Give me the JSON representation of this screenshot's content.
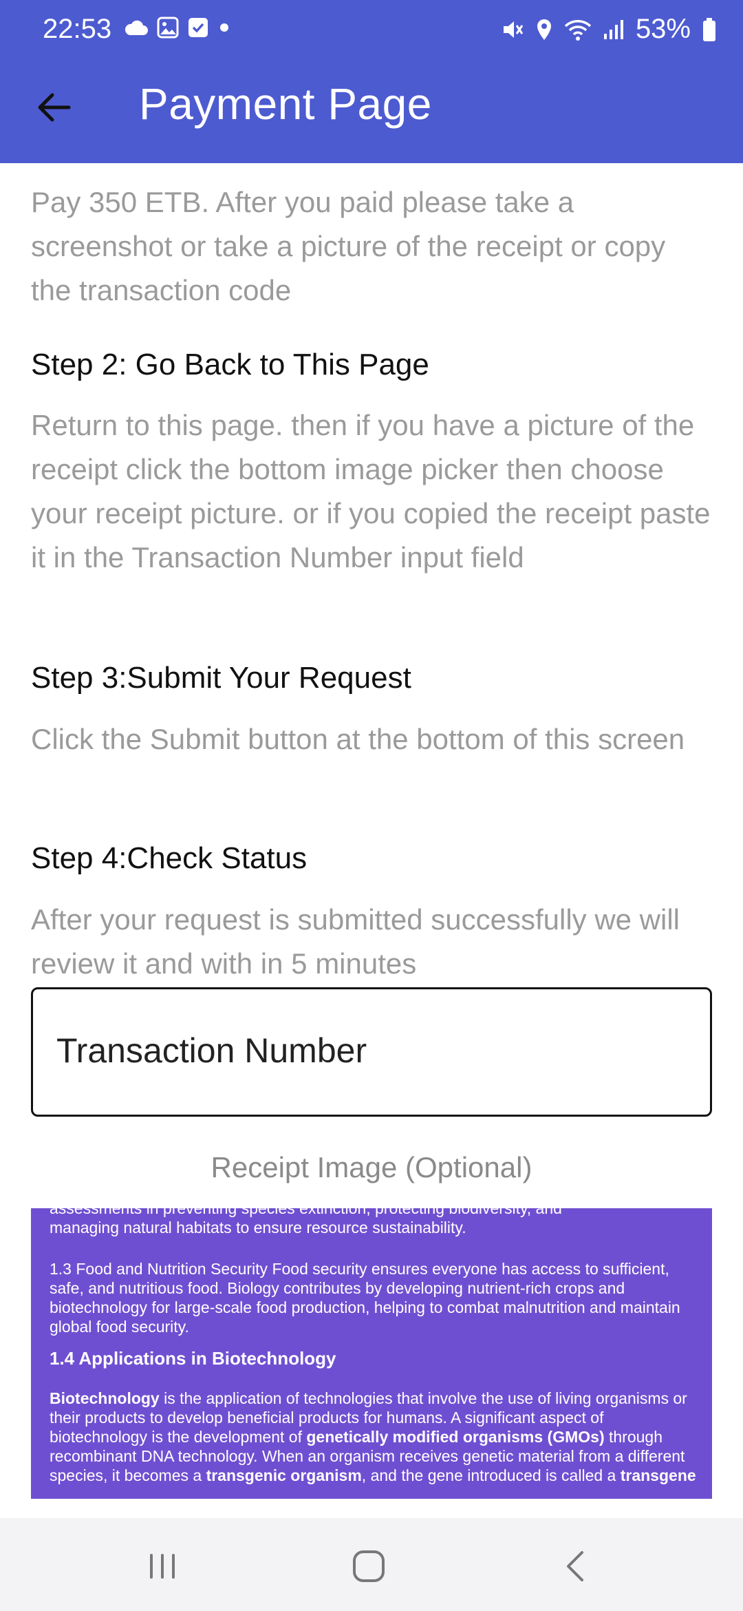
{
  "status_bar": {
    "time": "22:53",
    "battery": "53%",
    "left_icons": [
      "cloud-icon",
      "image-icon",
      "checkbox-icon",
      "dot-icon"
    ],
    "right_icons": [
      "mute-icon",
      "location-icon",
      "wifi-icon",
      "signal-icon",
      "battery-icon"
    ]
  },
  "header": {
    "title": "Payment Page",
    "back_icon": "arrow-left-icon",
    "bg_color": "#4d5bd0"
  },
  "content": {
    "intro": "Pay 350 ETB. After you paid  please take a screenshot or take a picture of the receipt or copy the transaction code",
    "steps": [
      {
        "title": "Step 2: Go Back to This Page",
        "body": "Return to this page. then if you have a picture of the receipt click the bottom image picker then choose your receipt picture. or if you copied the receipt paste it in the Transaction Number input field"
      },
      {
        "title": "Step 3:Submit Your Request",
        "body": "Click the Submit button at the bottom of this screen"
      },
      {
        "title": "Step 4:Check Status",
        "body": "After your request is submitted successfully we will review it and with in 5 minutes"
      }
    ],
    "transaction_field": {
      "label": "Transaction Number"
    },
    "receipt_label": "Receipt Image (Optional)",
    "receipt_preview": {
      "bg_color": "#6f4fd1",
      "top_line_partial": "assessments in preventing species extinction, protecting biodiversity, and",
      "top_line": "managing natural habitats to ensure resource sustainability.",
      "food_security": "1.3 Food and Nutrition Security Food security ensures everyone has access to sufficient, safe, and nutritious food. Biology contributes by developing nutrient-rich crops and biotechnology for large-scale food production, helping to combat malnutrition and maintain global food security.",
      "heading": "1.4 Applications in Biotechnology",
      "biotech_term": "Biotechnology",
      "biotech_body_1": " is the application of technologies that involve the use of living organisms or their products to develop beneficial products for humans. A significant aspect of biotechnology is the development of ",
      "gmo_term": "genetically modified organisms (GMOs)",
      "biotech_body_2": " through recombinant DNA technology. When an organism receives genetic material from a different species, it becomes a ",
      "transgenic_term": "transgenic organism",
      "biotech_body_3": ", and the gene introduced is called a ",
      "transgene_term": "transgene"
    }
  },
  "nav_bar": {
    "buttons": [
      "recent-apps-icon",
      "home-icon",
      "back-icon"
    ]
  }
}
